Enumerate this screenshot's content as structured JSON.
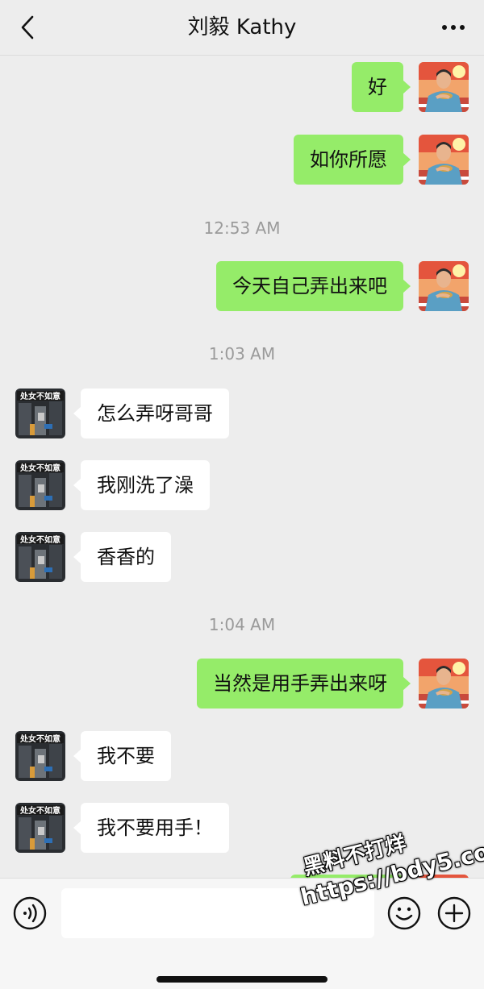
{
  "header": {
    "title": "刘毅 Kathy",
    "back_icon": "chevron-left-icon",
    "more_icon": "more-dots-icon"
  },
  "messages": [
    {
      "side": "me",
      "text": "好"
    },
    {
      "side": "me",
      "text": "如你所愿"
    },
    {
      "type": "time",
      "text": "12:53 AM"
    },
    {
      "side": "me",
      "text": "今天自己弄出来吧"
    },
    {
      "type": "time",
      "text": "1:03 AM"
    },
    {
      "side": "them",
      "text": "怎么弄呀哥哥"
    },
    {
      "side": "them",
      "text": "我刚洗了澡"
    },
    {
      "side": "them",
      "text": "香香的"
    },
    {
      "type": "time",
      "text": "1:04 AM"
    },
    {
      "side": "me",
      "text": "当然是用手弄出来呀"
    },
    {
      "side": "them",
      "text": "我不要"
    },
    {
      "side": "them",
      "text": "我不要用手！"
    }
  ],
  "input_bar": {
    "placeholder": "",
    "voice_icon": "voice-icon",
    "emoji_icon": "emoji-icon",
    "plus_icon": "plus-icon"
  },
  "watermark": {
    "line1": "黑料不打烊",
    "line2": "https://bdy5.co"
  },
  "colors": {
    "background": "#ededed",
    "my_bubble": "#95ec69",
    "their_bubble": "#ffffff",
    "timestamp": "#9a9a9a"
  }
}
